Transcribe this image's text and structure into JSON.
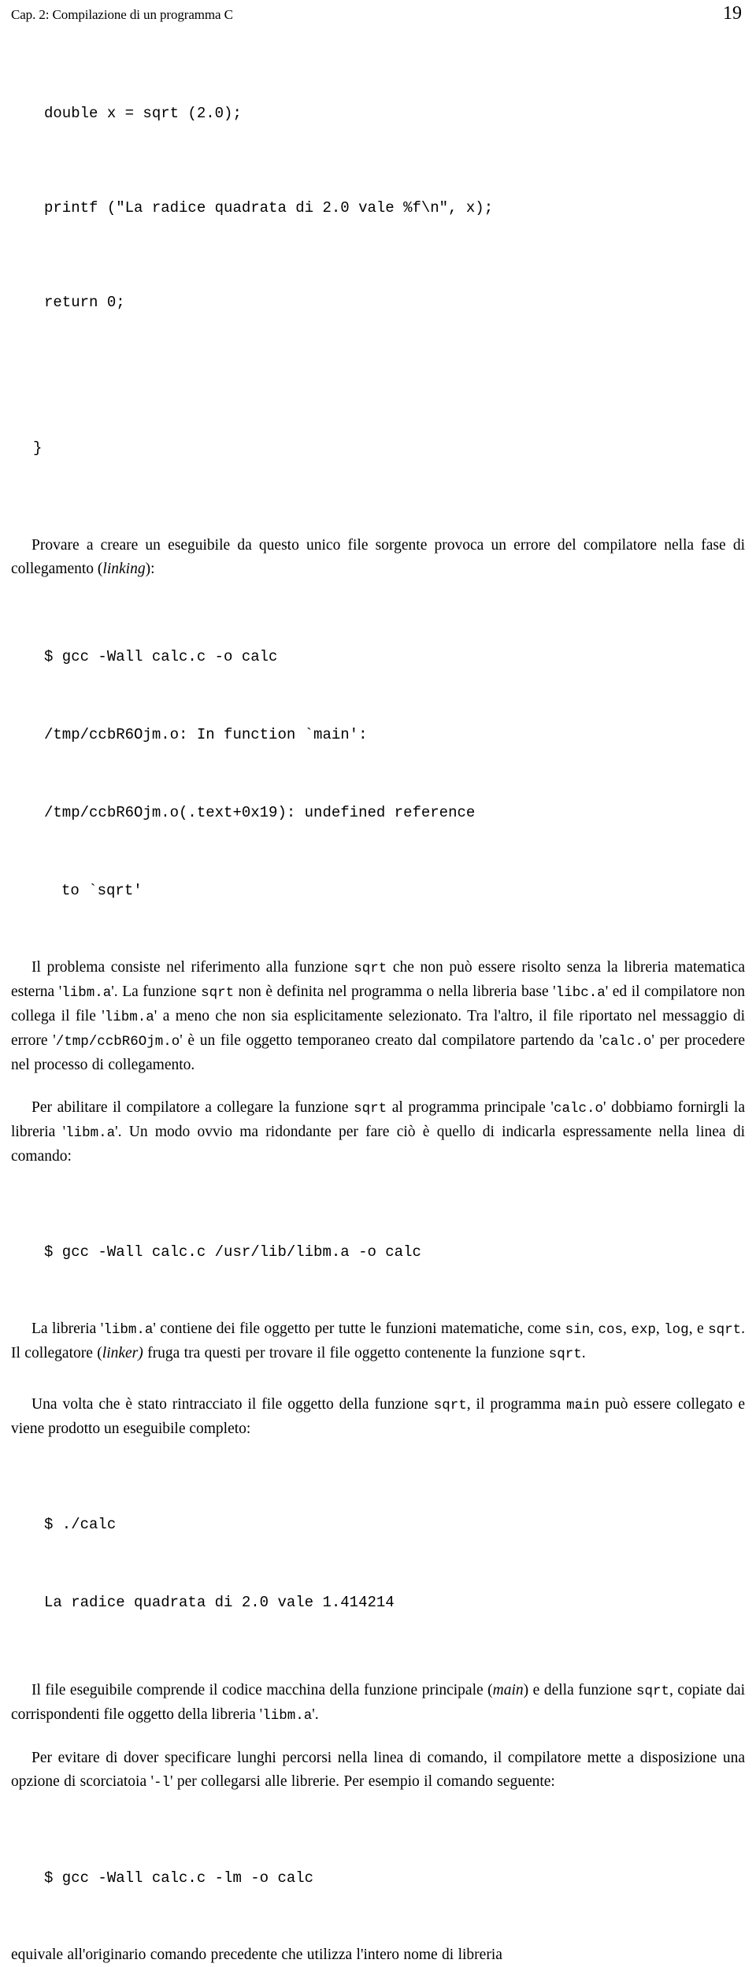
{
  "header": {
    "chapter_title": "Cap. 2: Compilazione di un programma C",
    "page_number": "19"
  },
  "code_listing_top": {
    "line1": "double x = sqrt (2.0);",
    "line2": "printf (\"La radice quadrata di 2.0 vale %f\\n\", x);",
    "line3": "return 0;",
    "line4": "}"
  },
  "paragraph_1": {
    "text": "Provare a creare un eseguibile da questo unico file sorgente provoca  un errore del compilatore nella fase di collegamento (",
    "italic": "linking",
    "tail": "):"
  },
  "terminal_error": {
    "cmd": "$ gcc -Wall calc.c -o calc",
    "out1": "/tmp/ccbR6Ojm.o: In function `main':",
    "out2": "/tmp/ccbR6Ojm.o(.text+0x19): undefined reference",
    "out3": "to `sqrt'"
  },
  "paragraph_2": {
    "s1": "Il problema consiste nel riferimento alla funzione ",
    "c1": "sqrt",
    "s2": " che non può essere risolto senza la libreria matematica esterna '",
    "c2": "libm.a",
    "s3": "'. La funzione ",
    "c3": "sqrt",
    "s4": " non è definita nel programma o nella libreria base '",
    "c4": "libc.a",
    "s5": "' ed il compilatore non collega il file '",
    "c5": "libm.a",
    "s6": "' a meno che non sia esplicitamente selezionato. Tra l'altro, il file riportato nel messaggio di errore '",
    "c6": "/tmp/ccbR6Ojm.o",
    "s7": "' è un file oggetto temporaneo creato dal compilatore partendo da '",
    "c7": "calc.o",
    "s8": "' per procedere nel processo di collegamento."
  },
  "paragraph_3": {
    "s1": "Per abilitare il compilatore a collegare la funzione ",
    "c1": "sqrt",
    "s2": " al programma principale '",
    "c2": "calc.o",
    "s3": "' dobbiamo fornirgli la libreria '",
    "c3": "libm.a",
    "s4": "'. Un modo ovvio ma ridondante per fare ciò è quello di indicarla espressamente nella linea di comando:"
  },
  "command_full_path": {
    "cmd": "$ gcc -Wall calc.c /usr/lib/libm.a -o calc"
  },
  "paragraph_4": {
    "s1": "La libreria '",
    "c1": "libm.a",
    "s2": "' contiene dei file oggetto per tutte le funzioni matematiche, come ",
    "c2": "sin",
    "s3": ", ",
    "c3": "cos",
    "s4": ", ",
    "c4": "exp",
    "s5": ", ",
    "c5": "log",
    "s6": ", e ",
    "c6": "sqrt",
    "s7": ". Il collegatore (",
    "i1": "linker)",
    "s8": " fruga tra questi per trovare il file oggetto contenente la funzione ",
    "c7": "sqrt",
    "s9": "."
  },
  "paragraph_5": {
    "s1": "Una volta che è stato rintracciato il file oggetto della funzione ",
    "c1": "sqrt",
    "s2": ", il programma ",
    "c2": "main",
    "s3": " può essere collegato e viene prodotto un eseguibile completo:"
  },
  "terminal_run": {
    "cmd": "$ ./calc",
    "out1": "La radice quadrata di 2.0 vale 1.414214"
  },
  "paragraph_6": {
    "s1": "Il file eseguibile comprende il codice macchina della funzione principale (",
    "i1": "main",
    "s2": ") e della funzione ",
    "c1": "sqrt",
    "s3": ", copiate dai corrispondenti file oggetto della libreria '",
    "c2": "libm.a",
    "s4": "'."
  },
  "paragraph_7": {
    "s1": "Per evitare di dover specificare lunghi percorsi nella linea di comando, il compilatore mette a disposizione una opzione di scorciatoia '",
    "c1": "-l",
    "s2": "' per collegarsi alle librerie. Per esempio il comando seguente:"
  },
  "command_shortflag": {
    "cmd": "$ gcc -Wall calc.c -lm -o calc"
  },
  "paragraph_8": {
    "s1": "equivale all'originario comando precedente che utilizza l'intero nome di libreria"
  },
  "colors": {
    "text": "#000000",
    "background": "#ffffff"
  }
}
